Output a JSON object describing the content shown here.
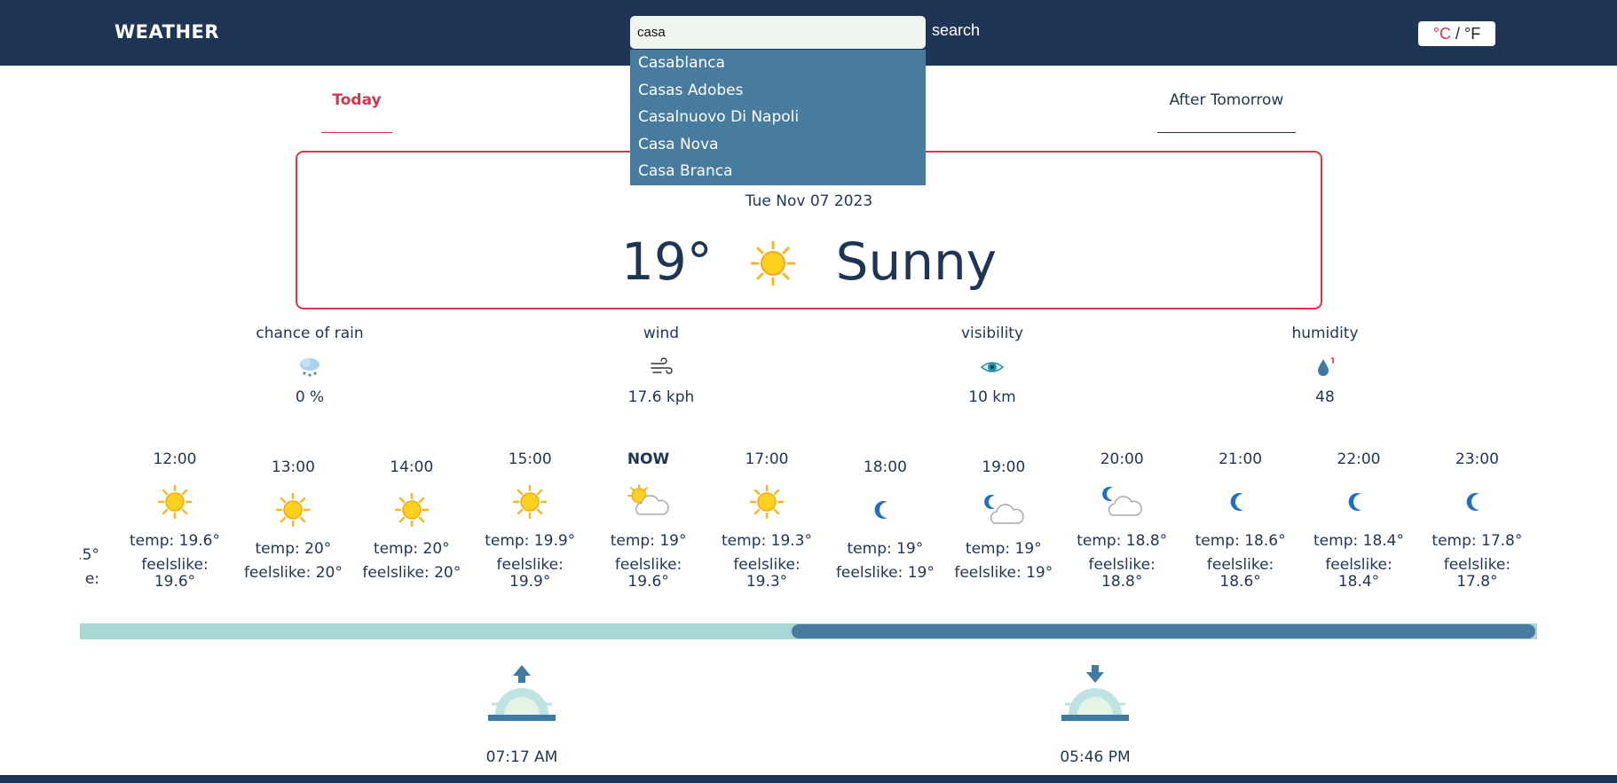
{
  "header": {
    "brand": "WEATHER",
    "search_value": "casa",
    "search_label": "search",
    "unit_c": "°C",
    "unit_sep": " / ",
    "unit_f": "°F"
  },
  "suggestions": [
    "Casablanca",
    "Casas Adobes",
    "Casalnuovo Di Napoli",
    "Casa Nova",
    "Casa Branca"
  ],
  "tabs": {
    "today": "Today",
    "after_tomorrow": "After Tomorrow"
  },
  "current": {
    "date": "Tue Nov 07 2023",
    "temp": "19°",
    "condition": "Sunny",
    "icon": "sun-icon"
  },
  "stats": [
    {
      "label": "chance of rain",
      "value": "0 %",
      "icon": "rain-cloud-icon"
    },
    {
      "label": "wind",
      "value": "17.6 kph",
      "icon": "wind-icon"
    },
    {
      "label": "visibility",
      "value": "10 km",
      "icon": "eye-icon"
    },
    {
      "label": "humidity",
      "value": "48",
      "icon": "droplet-icon"
    }
  ],
  "hourly": {
    "partial_temp": ".5°",
    "partial_feels": "e:",
    "hours": [
      {
        "time": "12:00",
        "icon": "sun-icon",
        "temp": "temp: 19.6°",
        "feels": "feelslike: 19.6°"
      },
      {
        "time": "13:00",
        "icon": "sun-icon",
        "temp": "temp: 20°",
        "feels": "feelslike: 20°"
      },
      {
        "time": "14:00",
        "icon": "sun-icon",
        "temp": "temp: 20°",
        "feels": "feelslike: 20°"
      },
      {
        "time": "15:00",
        "icon": "sun-icon",
        "temp": "temp: 19.9°",
        "feels": "feelslike: 19.9°"
      },
      {
        "time": "NOW",
        "icon": "partly-cloudy-sun-icon",
        "temp": "temp: 19°",
        "feels": "feelslike: 19.6°"
      },
      {
        "time": "17:00",
        "icon": "sun-icon",
        "temp": "temp: 19.3°",
        "feels": "feelslike: 19.3°"
      },
      {
        "time": "18:00",
        "icon": "moon-icon",
        "temp": "temp: 19°",
        "feels": "feelslike: 19°"
      },
      {
        "time": "19:00",
        "icon": "partly-cloudy-moon-icon",
        "temp": "temp: 19°",
        "feels": "feelslike: 19°"
      },
      {
        "time": "20:00",
        "icon": "partly-cloudy-moon-icon",
        "temp": "temp: 18.8°",
        "feels": "feelslike: 18.8°"
      },
      {
        "time": "21:00",
        "icon": "moon-icon",
        "temp": "temp: 18.6°",
        "feels": "feelslike: 18.6°"
      },
      {
        "time": "22:00",
        "icon": "moon-icon",
        "temp": "temp: 18.4°",
        "feels": "feelslike: 18.4°"
      },
      {
        "time": "23:00",
        "icon": "moon-icon",
        "temp": "temp: 17.8°",
        "feels": "feelslike: 17.8°"
      }
    ]
  },
  "sun": {
    "sunrise": "07:17 AM",
    "sunset": "05:46 PM"
  },
  "colors": {
    "navy": "#1e3556",
    "accent_red": "#d9354b",
    "dropdown_blue": "#487c9e",
    "track_teal": "#a8d7d8"
  }
}
